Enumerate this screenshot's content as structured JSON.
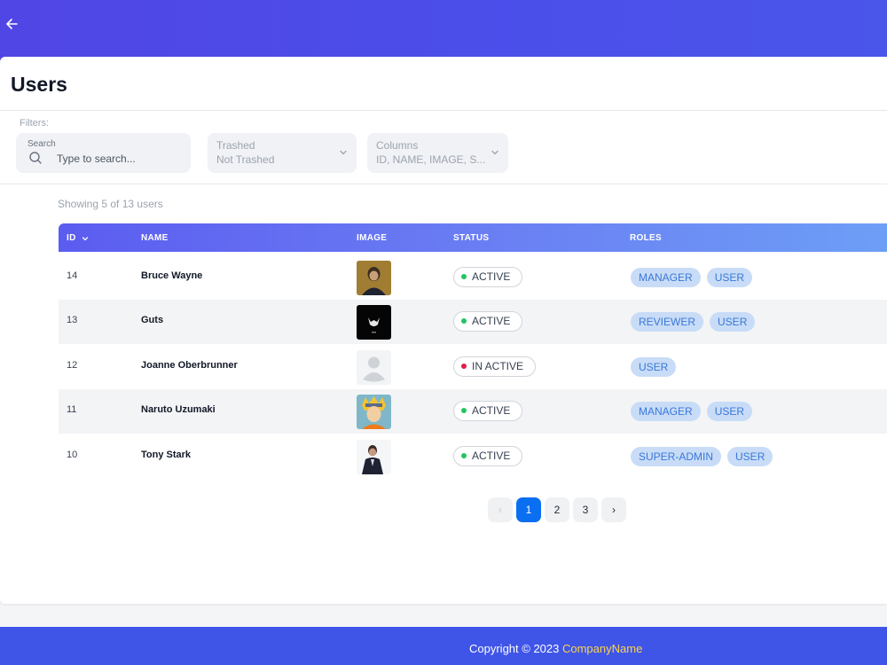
{
  "page": {
    "title": "Users"
  },
  "filters": {
    "label": "Filters:",
    "search": {
      "label": "Search",
      "placeholder": "Type to search..."
    },
    "trashed": {
      "label": "Trashed",
      "value": "Not Trashed"
    },
    "columns": {
      "label": "Columns",
      "value": "ID, NAME, IMAGE, S..."
    }
  },
  "summary": "Showing 5 of 13 users",
  "table": {
    "headers": {
      "id": "ID",
      "name": "NAME",
      "image": "IMAGE",
      "status": "STATUS",
      "roles": "ROLES"
    },
    "rows": [
      {
        "id": "14",
        "name": "Bruce Wayne",
        "status": "ACTIVE",
        "roles": [
          "MANAGER",
          "USER"
        ]
      },
      {
        "id": "13",
        "name": "Guts",
        "status": "ACTIVE",
        "roles": [
          "REVIEWER",
          "USER"
        ]
      },
      {
        "id": "12",
        "name": "Joanne Oberbrunner",
        "status": "IN ACTIVE",
        "roles": [
          "USER"
        ]
      },
      {
        "id": "11",
        "name": "Naruto Uzumaki",
        "status": "ACTIVE",
        "roles": [
          "MANAGER",
          "USER"
        ]
      },
      {
        "id": "10",
        "name": "Tony Stark",
        "status": "ACTIVE",
        "roles": [
          "SUPER-ADMIN",
          "USER"
        ]
      }
    ]
  },
  "pagination": {
    "prev": "‹",
    "pages": [
      "1",
      "2",
      "3"
    ],
    "next": "›",
    "current": "1"
  },
  "footer": {
    "copyright": "Copyright © 2023",
    "company": "CompanyName"
  },
  "colors": {
    "header_bg": "#4b4fea",
    "footer_bg": "#3f55e8",
    "active_dot": "#22c55e",
    "inactive_dot": "#e11d48",
    "role_bg": "#c8dcf7",
    "role_text": "#3a78d9",
    "page_active": "#0b6ff2",
    "company_text": "#fcd34d"
  },
  "icons": {
    "back": "arrow-left-icon",
    "search": "search-icon",
    "dropdown": "chevron-down-icon",
    "sort": "chevron-down-icon"
  }
}
